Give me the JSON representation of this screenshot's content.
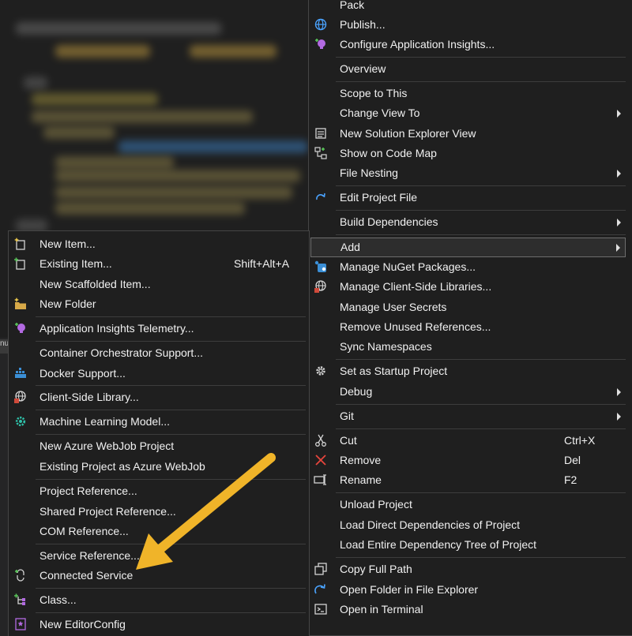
{
  "context_menu": {
    "items": [
      {
        "label": "Pack"
      },
      {
        "label": "Publish...",
        "icon": "globe-publish-icon"
      },
      {
        "label": "Configure Application Insights...",
        "icon": "application-insights-icon"
      },
      {
        "label": "Overview"
      },
      {
        "label": "Scope to This"
      },
      {
        "label": "Change View To"
      },
      {
        "label": "New Solution Explorer View",
        "icon": "new-solution-explorer-view-icon"
      },
      {
        "label": "Show on Code Map",
        "icon": "code-map-icon"
      },
      {
        "label": "File Nesting"
      },
      {
        "label": "Edit Project File",
        "icon": "redo-arrow-icon"
      },
      {
        "label": "Build Dependencies"
      },
      {
        "label": "Add"
      },
      {
        "label": "Manage NuGet Packages...",
        "icon": "nuget-icon"
      },
      {
        "label": "Manage Client-Side Libraries...",
        "icon": "client-side-library-globe-icon"
      },
      {
        "label": "Manage User Secrets"
      },
      {
        "label": "Remove Unused References..."
      },
      {
        "label": "Sync Namespaces"
      },
      {
        "label": "Set as Startup Project",
        "icon": "gear-icon"
      },
      {
        "label": "Debug"
      },
      {
        "label": "Git"
      },
      {
        "label": "Cut",
        "shortcut": "Ctrl+X",
        "icon": "scissors-icon"
      },
      {
        "label": "Remove",
        "shortcut": "Del",
        "icon": "red-x-icon"
      },
      {
        "label": "Rename",
        "shortcut": "F2",
        "icon": "rename-icon"
      },
      {
        "label": "Unload Project"
      },
      {
        "label": "Load Direct Dependencies of Project"
      },
      {
        "label": "Load Entire Dependency Tree of Project"
      },
      {
        "label": "Copy Full Path",
        "icon": "copy-icon"
      },
      {
        "label": "Open Folder in File Explorer",
        "icon": "open-folder-arrow-icon"
      },
      {
        "label": "Open in Terminal",
        "icon": "terminal-icon"
      }
    ]
  },
  "add_submenu": {
    "items": [
      {
        "label": "New Item...",
        "icon": "new-item-icon"
      },
      {
        "label": "Existing Item...",
        "shortcut": "Shift+Alt+A",
        "icon": "existing-item-icon"
      },
      {
        "label": "New Scaffolded Item..."
      },
      {
        "label": "New Folder",
        "icon": "new-folder-icon"
      },
      {
        "label": "Application Insights Telemetry...",
        "icon": "application-insights-icon"
      },
      {
        "label": "Container Orchestrator Support..."
      },
      {
        "label": "Docker Support...",
        "icon": "docker-icon"
      },
      {
        "label": "Client-Side Library...",
        "icon": "client-side-library-globe-icon"
      },
      {
        "label": "Machine Learning Model...",
        "icon": "ml-model-gear-icon"
      },
      {
        "label": "New Azure WebJob Project"
      },
      {
        "label": "Existing Project as Azure WebJob"
      },
      {
        "label": "Project Reference..."
      },
      {
        "label": "Shared Project Reference..."
      },
      {
        "label": "COM Reference..."
      },
      {
        "label": "Service Reference..."
      },
      {
        "label": "Connected Service",
        "icon": "connected-service-icon"
      },
      {
        "label": "Class...",
        "icon": "class-icon"
      },
      {
        "label": "New EditorConfig",
        "icon": "editorconfig-icon"
      }
    ]
  },
  "left_edge_tab": "nu",
  "colors": {
    "menu_bg": "#1f1f1f",
    "menu_border": "#454545",
    "highlight_bg": "#2d2d2d",
    "annotation_arrow": "#f0b429"
  }
}
